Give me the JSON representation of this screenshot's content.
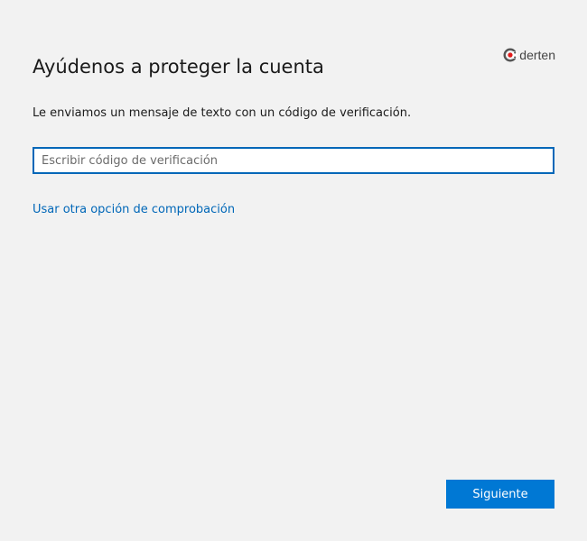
{
  "brand": {
    "logo_text": "derten",
    "icon": "brand-logo-icon",
    "accent_color": "#e21b1b"
  },
  "header": {
    "title": "Ayúdenos a proteger la cuenta"
  },
  "main": {
    "message": "Le enviamos un mensaje de texto con un código de verificación.",
    "code_input": {
      "value": "",
      "placeholder": "Escribir código de verificación"
    },
    "alt_option_link": "Usar otra opción de comprobación"
  },
  "footer": {
    "next_label": "Siguiente"
  },
  "colors": {
    "background": "#f2f2f2",
    "primary_button": "#0078d4",
    "link": "#0067b8",
    "input_border": "#0067b8"
  }
}
